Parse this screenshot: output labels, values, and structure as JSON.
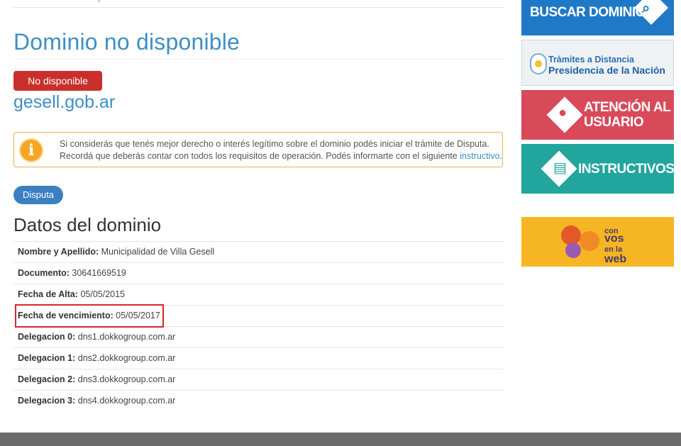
{
  "main": {
    "title": "Dominio no disponible",
    "status_badge": "No disponible",
    "domain": "gesell.gob.ar",
    "alert": {
      "line1": "Si considerás que tenés mejor derecho o interés legítimo sobre el dominio podés iniciar el trámite de Disputa.",
      "line2_prefix": "Recordá que deberás contar con todos los requisitos de operación. Podés informarte con el siguiente",
      "link_text": "instructivo",
      "line2_suffix": "."
    },
    "dispute_button": "Disputa",
    "data_heading": "Datos del dominio",
    "rows": [
      {
        "key": "Nombre y Apellido:",
        "value": "Municipalidad de Villa Gesell"
      },
      {
        "key": "Documento:",
        "value": "30641669519"
      },
      {
        "key": "Fecha de Alta:",
        "value": "05/05/2015"
      },
      {
        "key": "Fecha de vencimiento:",
        "value": "05/05/2017"
      },
      {
        "key": "Delegacion 0:",
        "value": "dns1.dokkogroup.com.ar"
      },
      {
        "key": "Delegacion 1:",
        "value": "dns2.dokkogroup.com.ar"
      },
      {
        "key": "Delegacion 2:",
        "value": "dns3.dokkogroup.com.ar"
      },
      {
        "key": "Delegacion 3:",
        "value": "dns4.dokkogroup.com.ar"
      }
    ]
  },
  "sidebar": {
    "buscar": "BUSCAR DOMINIOS",
    "tramites_line1": "Trámites a Distancia",
    "tramites_line2": "Presidencia de la Nación",
    "atencion_line1": "ATENCIÓN AL",
    "atencion_line2": "USUARIO",
    "instructivos": "INSTRUCTIVOS",
    "convos_line1": "con",
    "convos_line2": "vos",
    "convos_line3": "en la",
    "convos_line4": "web"
  },
  "icons": {
    "info": "info-icon",
    "search": "magnifier-icon",
    "user": "user-icon",
    "document": "document-icon"
  },
  "colors": {
    "title_blue": "#3d8fc4",
    "badge_red": "#c9302c",
    "alert_border": "#f0ad4e",
    "button_blue": "#3b7fc1",
    "highlight_red": "#d9262c"
  }
}
